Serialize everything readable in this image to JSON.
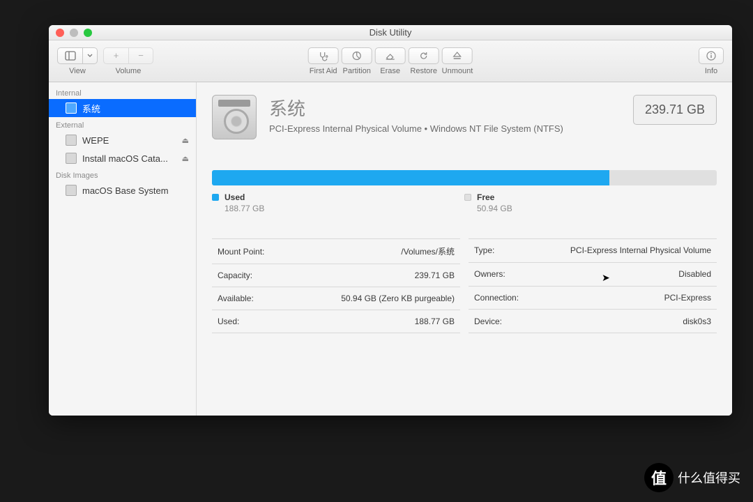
{
  "window": {
    "title": "Disk Utility"
  },
  "toolbar": {
    "view": "View",
    "volume": "Volume",
    "first_aid": "First Aid",
    "partition": "Partition",
    "erase": "Erase",
    "restore": "Restore",
    "unmount": "Unmount",
    "info": "Info"
  },
  "sidebar": {
    "sections": {
      "internal": "Internal",
      "external": "External",
      "disk_images": "Disk Images"
    },
    "internal_items": [
      {
        "label": "系统",
        "selected": true
      }
    ],
    "external_items": [
      {
        "label": "WEPE",
        "ejectable": true
      },
      {
        "label": "Install macOS Cata...",
        "ejectable": true
      }
    ],
    "disk_image_items": [
      {
        "label": "macOS Base System"
      }
    ]
  },
  "volume": {
    "name": "系统",
    "subtitle": "PCI-Express Internal Physical Volume • Windows NT File System (NTFS)",
    "size": "239.71 GB",
    "used_label": "Used",
    "used_value": "188.77 GB",
    "free_label": "Free",
    "free_value": "50.94 GB",
    "used_pct": 78.7
  },
  "details": {
    "left": [
      {
        "k": "Mount Point:",
        "v": "/Volumes/系统"
      },
      {
        "k": "Capacity:",
        "v": "239.71 GB"
      },
      {
        "k": "Available:",
        "v": "50.94 GB (Zero KB purgeable)"
      },
      {
        "k": "Used:",
        "v": "188.77 GB"
      }
    ],
    "right": [
      {
        "k": "Type:",
        "v": "PCI-Express Internal Physical Volume"
      },
      {
        "k": "Owners:",
        "v": "Disabled"
      },
      {
        "k": "Connection:",
        "v": "PCI-Express"
      },
      {
        "k": "Device:",
        "v": "disk0s3"
      }
    ]
  },
  "watermark": "什么值得买"
}
